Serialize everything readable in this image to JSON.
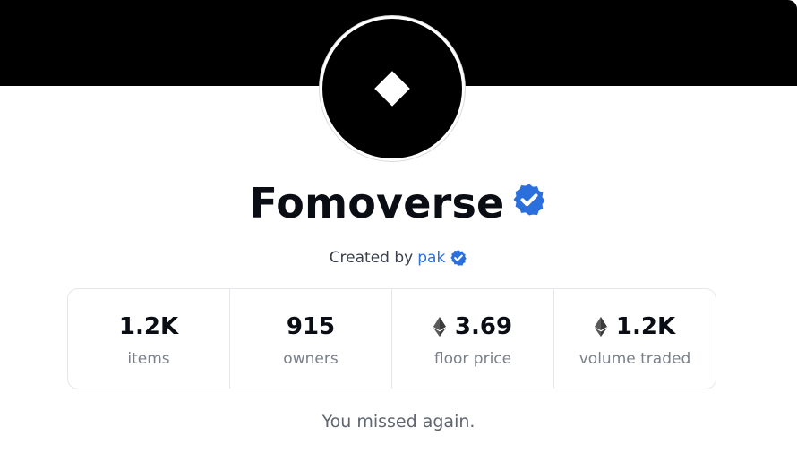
{
  "collection": {
    "name": "Fomoverse",
    "creator_prefix": "Created by",
    "creator_name": "pak",
    "message": "You missed again."
  },
  "stats": [
    {
      "value": "1.2K",
      "label": "items",
      "currency": ""
    },
    {
      "value": "915",
      "label": "owners",
      "currency": ""
    },
    {
      "value": "3.69",
      "label": "floor price",
      "currency": "eth-icon"
    },
    {
      "value": "1.2K",
      "label": "volume traded",
      "currency": "eth-icon"
    }
  ],
  "colors": {
    "banner": "#000000",
    "verified": "#2a6fdb",
    "link": "#2a6fdb",
    "text": "#0b0d14",
    "muted": "#7a7f89"
  },
  "icons": {
    "verified": "verified-badge-icon",
    "avatar": "diamond-icon",
    "currency": "eth-icon"
  }
}
